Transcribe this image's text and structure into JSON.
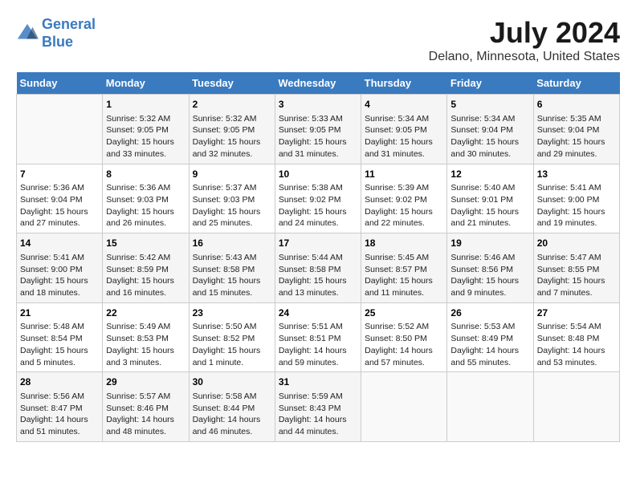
{
  "logo": {
    "line1": "General",
    "line2": "Blue"
  },
  "title": "July 2024",
  "subtitle": "Delano, Minnesota, United States",
  "days_of_week": [
    "Sunday",
    "Monday",
    "Tuesday",
    "Wednesday",
    "Thursday",
    "Friday",
    "Saturday"
  ],
  "weeks": [
    [
      {
        "num": "",
        "detail": ""
      },
      {
        "num": "1",
        "detail": "Sunrise: 5:32 AM\nSunset: 9:05 PM\nDaylight: 15 hours\nand 33 minutes."
      },
      {
        "num": "2",
        "detail": "Sunrise: 5:32 AM\nSunset: 9:05 PM\nDaylight: 15 hours\nand 32 minutes."
      },
      {
        "num": "3",
        "detail": "Sunrise: 5:33 AM\nSunset: 9:05 PM\nDaylight: 15 hours\nand 31 minutes."
      },
      {
        "num": "4",
        "detail": "Sunrise: 5:34 AM\nSunset: 9:05 PM\nDaylight: 15 hours\nand 31 minutes."
      },
      {
        "num": "5",
        "detail": "Sunrise: 5:34 AM\nSunset: 9:04 PM\nDaylight: 15 hours\nand 30 minutes."
      },
      {
        "num": "6",
        "detail": "Sunrise: 5:35 AM\nSunset: 9:04 PM\nDaylight: 15 hours\nand 29 minutes."
      }
    ],
    [
      {
        "num": "7",
        "detail": "Sunrise: 5:36 AM\nSunset: 9:04 PM\nDaylight: 15 hours\nand 27 minutes."
      },
      {
        "num": "8",
        "detail": "Sunrise: 5:36 AM\nSunset: 9:03 PM\nDaylight: 15 hours\nand 26 minutes."
      },
      {
        "num": "9",
        "detail": "Sunrise: 5:37 AM\nSunset: 9:03 PM\nDaylight: 15 hours\nand 25 minutes."
      },
      {
        "num": "10",
        "detail": "Sunrise: 5:38 AM\nSunset: 9:02 PM\nDaylight: 15 hours\nand 24 minutes."
      },
      {
        "num": "11",
        "detail": "Sunrise: 5:39 AM\nSunset: 9:02 PM\nDaylight: 15 hours\nand 22 minutes."
      },
      {
        "num": "12",
        "detail": "Sunrise: 5:40 AM\nSunset: 9:01 PM\nDaylight: 15 hours\nand 21 minutes."
      },
      {
        "num": "13",
        "detail": "Sunrise: 5:41 AM\nSunset: 9:00 PM\nDaylight: 15 hours\nand 19 minutes."
      }
    ],
    [
      {
        "num": "14",
        "detail": "Sunrise: 5:41 AM\nSunset: 9:00 PM\nDaylight: 15 hours\nand 18 minutes."
      },
      {
        "num": "15",
        "detail": "Sunrise: 5:42 AM\nSunset: 8:59 PM\nDaylight: 15 hours\nand 16 minutes."
      },
      {
        "num": "16",
        "detail": "Sunrise: 5:43 AM\nSunset: 8:58 PM\nDaylight: 15 hours\nand 15 minutes."
      },
      {
        "num": "17",
        "detail": "Sunrise: 5:44 AM\nSunset: 8:58 PM\nDaylight: 15 hours\nand 13 minutes."
      },
      {
        "num": "18",
        "detail": "Sunrise: 5:45 AM\nSunset: 8:57 PM\nDaylight: 15 hours\nand 11 minutes."
      },
      {
        "num": "19",
        "detail": "Sunrise: 5:46 AM\nSunset: 8:56 PM\nDaylight: 15 hours\nand 9 minutes."
      },
      {
        "num": "20",
        "detail": "Sunrise: 5:47 AM\nSunset: 8:55 PM\nDaylight: 15 hours\nand 7 minutes."
      }
    ],
    [
      {
        "num": "21",
        "detail": "Sunrise: 5:48 AM\nSunset: 8:54 PM\nDaylight: 15 hours\nand 5 minutes."
      },
      {
        "num": "22",
        "detail": "Sunrise: 5:49 AM\nSunset: 8:53 PM\nDaylight: 15 hours\nand 3 minutes."
      },
      {
        "num": "23",
        "detail": "Sunrise: 5:50 AM\nSunset: 8:52 PM\nDaylight: 15 hours\nand 1 minute."
      },
      {
        "num": "24",
        "detail": "Sunrise: 5:51 AM\nSunset: 8:51 PM\nDaylight: 14 hours\nand 59 minutes."
      },
      {
        "num": "25",
        "detail": "Sunrise: 5:52 AM\nSunset: 8:50 PM\nDaylight: 14 hours\nand 57 minutes."
      },
      {
        "num": "26",
        "detail": "Sunrise: 5:53 AM\nSunset: 8:49 PM\nDaylight: 14 hours\nand 55 minutes."
      },
      {
        "num": "27",
        "detail": "Sunrise: 5:54 AM\nSunset: 8:48 PM\nDaylight: 14 hours\nand 53 minutes."
      }
    ],
    [
      {
        "num": "28",
        "detail": "Sunrise: 5:56 AM\nSunset: 8:47 PM\nDaylight: 14 hours\nand 51 minutes."
      },
      {
        "num": "29",
        "detail": "Sunrise: 5:57 AM\nSunset: 8:46 PM\nDaylight: 14 hours\nand 48 minutes."
      },
      {
        "num": "30",
        "detail": "Sunrise: 5:58 AM\nSunset: 8:44 PM\nDaylight: 14 hours\nand 46 minutes."
      },
      {
        "num": "31",
        "detail": "Sunrise: 5:59 AM\nSunset: 8:43 PM\nDaylight: 14 hours\nand 44 minutes."
      },
      {
        "num": "",
        "detail": ""
      },
      {
        "num": "",
        "detail": ""
      },
      {
        "num": "",
        "detail": ""
      }
    ]
  ]
}
